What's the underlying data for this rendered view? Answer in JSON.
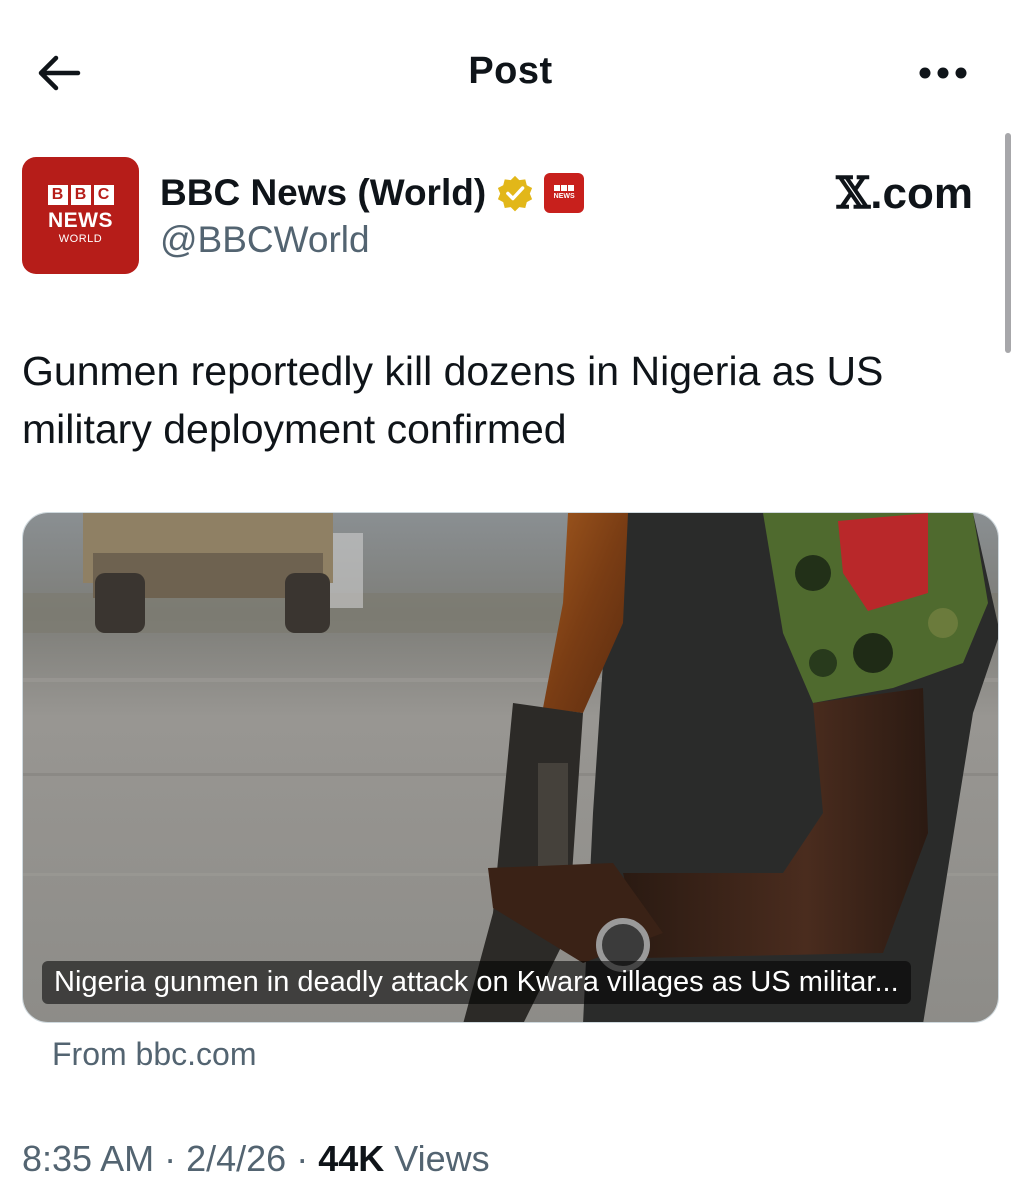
{
  "header": {
    "title": "Post"
  },
  "author": {
    "avatar": {
      "blocks": [
        "B",
        "B",
        "C"
      ],
      "line1": "NEWS",
      "line2": "WORLD"
    },
    "display_name": "BBC News (World)",
    "handle": "@BBCWorld",
    "verified_badge_color": "#e2b719",
    "affiliate_badge": {
      "mini_text": "NEWS"
    }
  },
  "source_brand": {
    "x": "𝕏",
    "suffix": ".com"
  },
  "post": {
    "text": "Gunmen reportedly kill dozens in Nigeria as US military deployment confirmed"
  },
  "card": {
    "caption": "Nigeria gunmen in deadly attack on Kwara villages as US militar...",
    "source": "From bbc.com"
  },
  "meta": {
    "time": "8:35 AM",
    "separator": " · ",
    "date": "2/4/26",
    "views_count": "44K",
    "views_label": "Views"
  },
  "colors": {
    "text": "#0f1419",
    "secondary": "#536471",
    "bbc_red": "#b61d19"
  }
}
